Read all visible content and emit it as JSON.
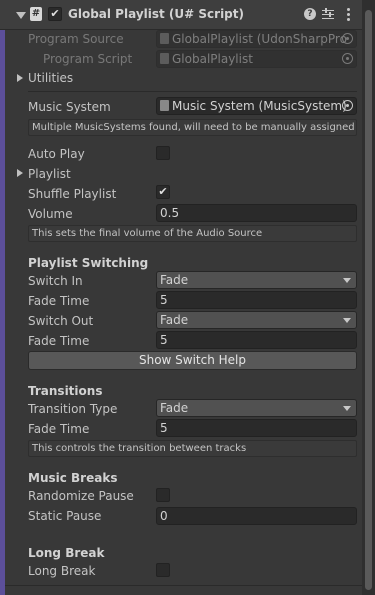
{
  "header": {
    "title": "Global Playlist (U# Script)",
    "enabled": true,
    "icons": [
      "collapse-triangle-icon",
      "script-icon",
      "enabled-checkbox-icon",
      "help-icon",
      "preset-icon",
      "kebab-menu-icon"
    ]
  },
  "program_source": {
    "label": "Program Source",
    "value": "GlobalPlaylist (UdonSharpPro"
  },
  "program_script": {
    "label": "Program Script",
    "value": "GlobalPlaylist"
  },
  "utilities": {
    "label": "Utilities"
  },
  "music_system": {
    "label": "Music System",
    "value": "Music System (MusicSystem)",
    "help": "Multiple MusicSystems found, will need to be manually assigned"
  },
  "auto_play": {
    "label": "Auto Play",
    "checked": false
  },
  "playlist": {
    "label": "Playlist"
  },
  "shuffle_playlist": {
    "label": "Shuffle Playlist",
    "checked": true,
    "check_glyph": "✔"
  },
  "volume": {
    "label": "Volume",
    "value": "0.5",
    "help": "This sets the final volume of the Audio Source"
  },
  "playlist_switching": {
    "heading": "Playlist Switching",
    "switch_in": {
      "label": "Switch In",
      "value": "Fade"
    },
    "fade_time_in": {
      "label": "Fade Time",
      "value": "5"
    },
    "switch_out": {
      "label": "Switch Out",
      "value": "Fade"
    },
    "fade_time_out": {
      "label": "Fade Time",
      "value": "5"
    },
    "help_button": "Show Switch Help"
  },
  "transitions": {
    "heading": "Transitions",
    "type": {
      "label": "Transition Type",
      "value": "Fade"
    },
    "fade_time": {
      "label": "Fade Time",
      "value": "5"
    },
    "help": "This controls the transition between tracks"
  },
  "music_breaks": {
    "heading": "Music Breaks",
    "randomize_pause": {
      "label": "Randomize Pause",
      "checked": false
    },
    "static_pause": {
      "label": "Static Pause",
      "value": "0"
    }
  },
  "long_break": {
    "heading": "Long Break",
    "toggle": {
      "label": "Long Break",
      "checked": false
    }
  },
  "colors": {
    "background": "#383838",
    "accent_bar": "#5c4f9a",
    "field": "#2a2a2a",
    "dropdown": "#515151"
  }
}
